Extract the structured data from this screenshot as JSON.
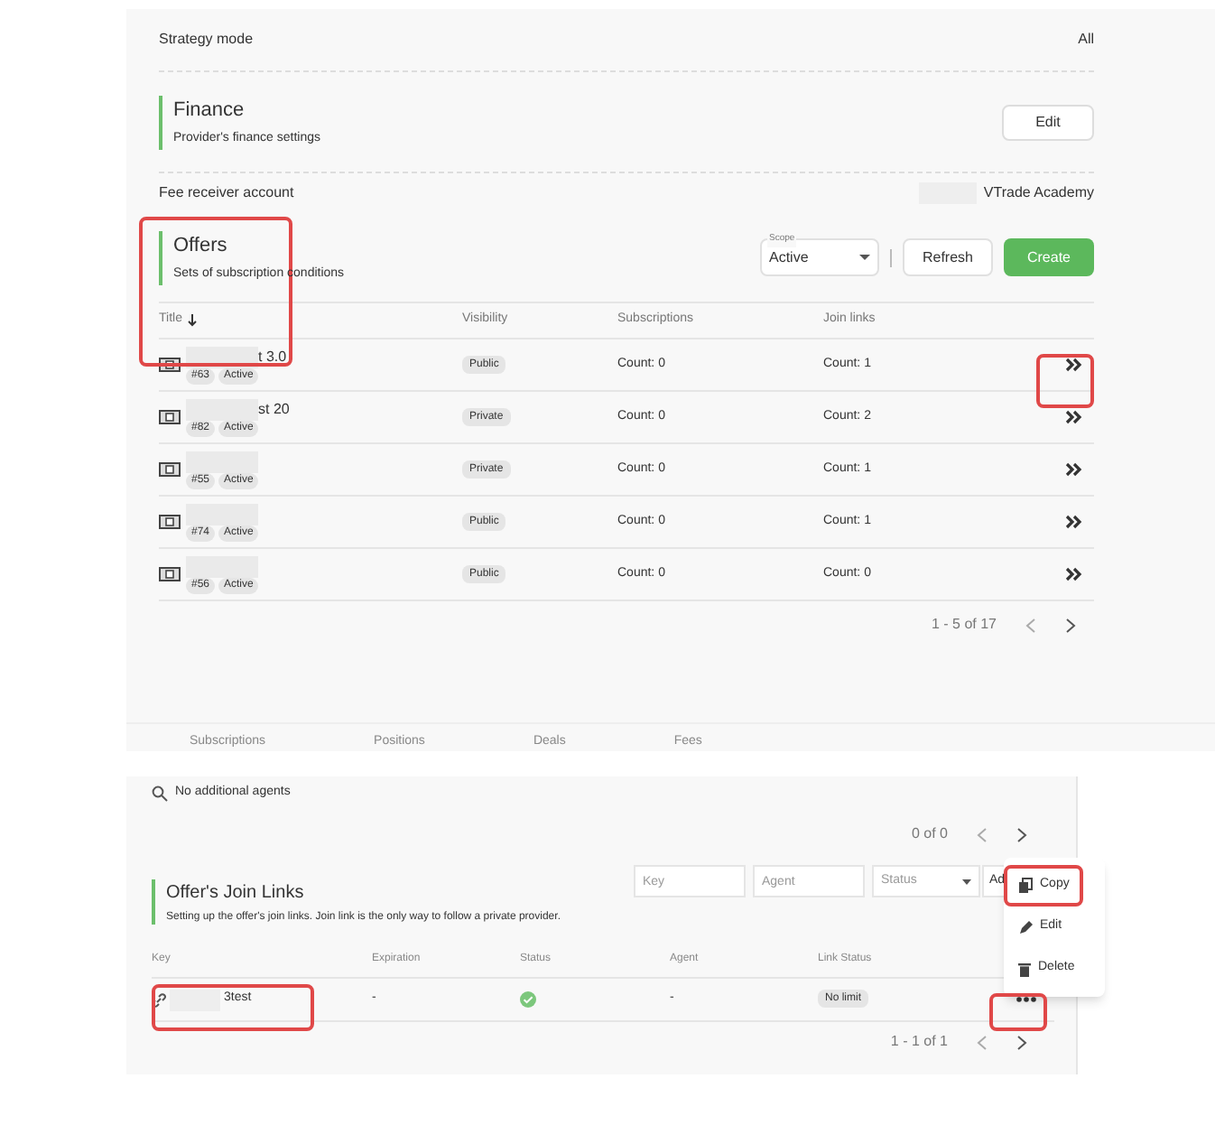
{
  "strategy_mode": {
    "label": "Strategy mode",
    "value": "All"
  },
  "finance": {
    "title": "Finance",
    "subtitle": "Provider's finance settings",
    "button": "Edit"
  },
  "fee_receiver": {
    "label": "Fee receiver account",
    "value": "VTrade Academy"
  },
  "offers": {
    "title": "Offers",
    "subtitle": "Sets of subscription conditions",
    "scope": {
      "label": "Scope",
      "value": "Active"
    },
    "refresh": "Refresh",
    "create": "Create",
    "columns": [
      "Title",
      "Visibility",
      "Subscriptions",
      "Join links"
    ],
    "rows": [
      {
        "title": "t 3.0",
        "id": "#63",
        "status": "Active",
        "visibility": "Public",
        "subscriptions": "Count: 0",
        "join_links": "Count: 1"
      },
      {
        "title": "st 20",
        "id": "#82",
        "status": "Active",
        "visibility": "Private",
        "subscriptions": "Count: 0",
        "join_links": "Count: 2"
      },
      {
        "id": "#55",
        "status": "Active",
        "visibility": "Private",
        "subscriptions": "Count: 0",
        "join_links": "Count: 1"
      },
      {
        "id": "#74",
        "status": "Active",
        "visibility": "Public",
        "subscriptions": "Count: 0",
        "join_links": "Count: 1"
      },
      {
        "id": "#56",
        "status": "Active",
        "visibility": "Public",
        "subscriptions": "Count: 0",
        "join_links": "Count: 0"
      }
    ],
    "pagination": "1 - 5 of 17"
  },
  "tabs": [
    {
      "label": "Subscriptions",
      "selected": false
    },
    {
      "label": "Positions",
      "selected": false
    },
    {
      "label": "Deals",
      "selected": false
    },
    {
      "label": "Fees",
      "selected": false
    }
  ],
  "agents": {
    "empty_text": "No additional agents",
    "pagination": "0 of 0"
  },
  "join_links": {
    "title": "Offer's Join Links",
    "subtitle": "Setting up the offer's join links. Join link is the only way to follow a private provider.",
    "filters": {
      "key_placeholder": "Key",
      "agent_placeholder": "Agent",
      "status_placeholder": "Status",
      "add": "Ad"
    },
    "columns": [
      "Key",
      "Expiration",
      "Status",
      "Agent",
      "Link Status"
    ],
    "rows": [
      {
        "key": "3test",
        "expiration": "-",
        "status_ok": true,
        "agent": "-",
        "link_status": "No limit"
      }
    ],
    "pagination": "1 - 1 of 1",
    "menu": [
      {
        "kind": "copy",
        "label": "Copy",
        "highlighted": true
      },
      {
        "kind": "edit",
        "label": "Edit",
        "highlighted": false
      },
      {
        "kind": "delete",
        "label": "Delete",
        "highlighted": false
      }
    ]
  }
}
